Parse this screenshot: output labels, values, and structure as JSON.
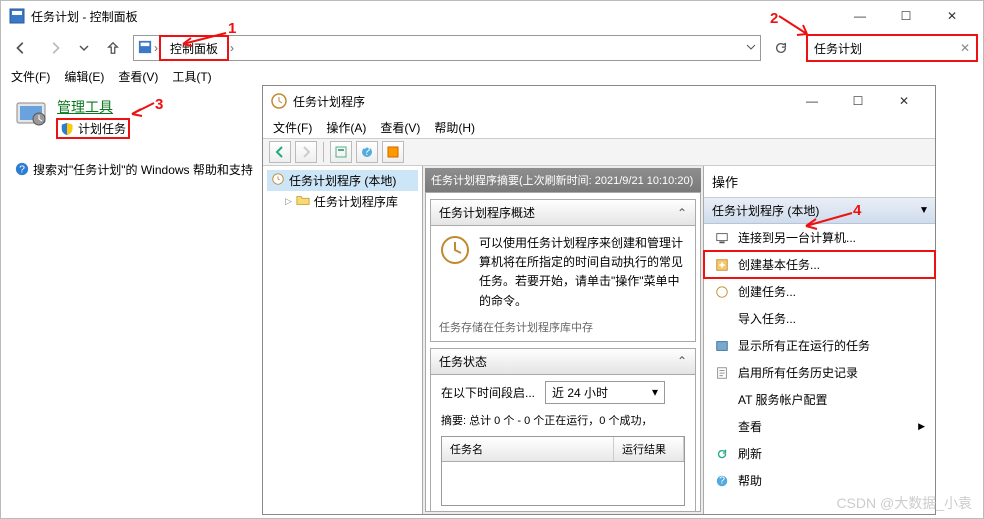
{
  "cp_window": {
    "title": "任务计划 - 控制面板",
    "breadcrumb_root": "控制面板",
    "search_placeholder": "任务计划",
    "menus": [
      "文件(F)",
      "编辑(E)",
      "查看(V)",
      "工具(T)"
    ],
    "category_link": "管理工具",
    "sub_link": "计划任务",
    "help_link": "搜索对\"任务计划\"的 Windows 帮助和支持"
  },
  "ts_window": {
    "title": "任务计划程序",
    "menus": [
      "文件(F)",
      "操作(A)",
      "查看(V)",
      "帮助(H)"
    ],
    "tree_root": "任务计划程序 (本地)",
    "tree_child": "任务计划程序库",
    "mid_title": "任务计划程序摘要(上次刷新时间: 2021/9/21 10:10:20)",
    "overview_heading": "任务计划程序概述",
    "overview_body": "可以使用任务计划程序来创建和管理计算机将在所指定的时间自动执行的常见任务。若要开始，请单击\"操作\"菜单中的命令。",
    "overview_footer": "任务存储在任务计划程序库中存",
    "status_heading": "任务状态",
    "status_label": "在以下时间段启...",
    "status_combo": "近 24 小时",
    "status_summary": "摘要: 总计 0 个 - 0 个正在运行，0 个成功，",
    "list_col1": "任务名",
    "list_col2": "运行结果",
    "actions_title": "操作",
    "actions_group": "任务计划程序 (本地)",
    "actions": {
      "connect": "连接到另一台计算机...",
      "create_basic": "创建基本任务...",
      "create": "创建任务...",
      "import": "导入任务...",
      "show_running": "显示所有正在运行的任务",
      "enable_history": "启用所有任务历史记录",
      "at_config": "AT 服务帐户配置",
      "view": "查看",
      "refresh": "刷新",
      "help": "帮助"
    }
  },
  "annotations": {
    "a1": "1",
    "a2": "2",
    "a3": "3",
    "a4": "4"
  },
  "watermark": "CSDN @大数据_小袁"
}
